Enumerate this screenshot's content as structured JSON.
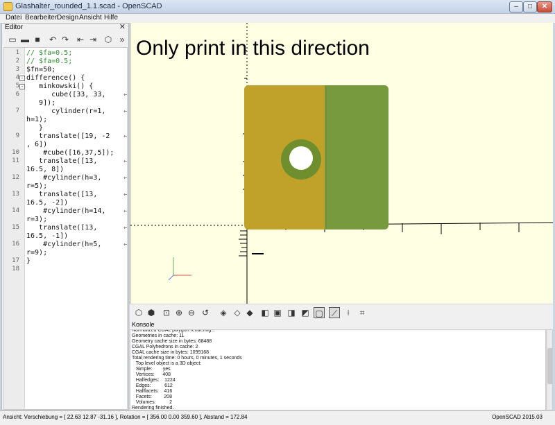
{
  "window": {
    "title": "Glashalter_rounded_1.1.scad - OpenSCAD",
    "min_label": "–",
    "max_label": "□",
    "close_label": "✕"
  },
  "menu": [
    "Datei",
    "Bearbeiten",
    "Design",
    "Ansicht",
    "Hilfe"
  ],
  "editor": {
    "title": "Editor",
    "close_label": "✕",
    "toolbar_icons": [
      "new-file-icon",
      "open-file-icon",
      "save-icon",
      "undo-icon",
      "redo-icon",
      "unindent-icon",
      "indent-icon",
      "preview-render-icon",
      "more-icon"
    ],
    "lines": [
      {
        "num": "1",
        "code": "// $fa=0.5;",
        "comment": true
      },
      {
        "num": "2",
        "code": "// $fa=0.5;",
        "comment": true
      },
      {
        "num": "3",
        "code": "$fn=50;",
        "comment": false
      },
      {
        "num": "4",
        "code": "difference() {",
        "comment": false
      },
      {
        "num": "5",
        "code": "   minkowski() {",
        "comment": false
      },
      {
        "num": "6",
        "code": "      cube([33, 33,",
        "cont": "   9]);",
        "comment": false
      },
      {
        "num": "7",
        "code": "      cylinder(r=1,",
        "cont": "h=1);",
        "comment": false
      },
      {
        "num": "",
        "code": "   }",
        "comment": false
      },
      {
        "num": "9",
        "code": "   translate([19, -2",
        "cont": ", 6])",
        "comment": false
      },
      {
        "num": "10",
        "code": "    #cube([16,37,5]);",
        "comment": false
      },
      {
        "num": "11",
        "code": "   translate([13,",
        "cont": "16.5, 8])",
        "comment": false
      },
      {
        "num": "12",
        "code": "    #cylinder(h=3,",
        "cont": "r=5);",
        "comment": false
      },
      {
        "num": "13",
        "code": "   translate([13,",
        "cont": "16.5, -2])",
        "comment": false
      },
      {
        "num": "14",
        "code": "    #cylinder(h=14,",
        "cont": "r=3);",
        "comment": false
      },
      {
        "num": "15",
        "code": "   translate([13,",
        "cont": "16.5, -1])",
        "comment": false
      },
      {
        "num": "16",
        "code": "    #cylinder(h=5,",
        "cont": "r=9);",
        "comment": false
      },
      {
        "num": "17",
        "code": "}",
        "comment": false
      },
      {
        "num": "18",
        "code": "",
        "comment": false
      }
    ]
  },
  "viewport": {
    "caption": "Only print in this direction",
    "background": "#ffffe4",
    "left_face_color": "#c0a22a",
    "right_face_color": "#779a3e",
    "hole_ring_color": "#6f8f2e"
  },
  "view_toolbar_icons": [
    "preview-icon",
    "render-icon",
    "view-all-icon",
    "zoom-in-icon",
    "zoom-out-icon",
    "reset-view-icon",
    "view-right-icon",
    "view-top-icon",
    "view-bottom-icon",
    "view-left-icon",
    "view-front-icon",
    "view-back-icon",
    "view-diagonal-icon",
    "view-center-icon",
    "perspective-icon",
    "orthogonal-icon",
    "show-axes-icon"
  ],
  "console": {
    "title": "Konsole",
    "lines": [
      "Normalized CGAL polygon rendering...",
      "Geometries in cache: 11",
      "Geometry cache size in bytes: 68488",
      "CGAL Polyhedrons in cache: 2",
      "CGAL cache size in bytes: 1099168",
      "Total rendering time: 0 hours, 0 minutes, 1 seconds",
      "   Top level object is a 3D object:",
      "   Simple:        yes",
      "   Vertices:      408",
      "   Halfedges:    1224",
      "   Edges:          612",
      "   Halffacets:    416",
      "   Facets:         208",
      "   Volumes:          2",
      "Rendering finished."
    ]
  },
  "status": {
    "left": "Ansicht: Verschiebung = [ 22.63 12.87 -31.16 ], Rotation = [ 356.00 0.00 359.60 ], Abstand = 172.84",
    "right": "OpenSCAD 2015.03"
  }
}
